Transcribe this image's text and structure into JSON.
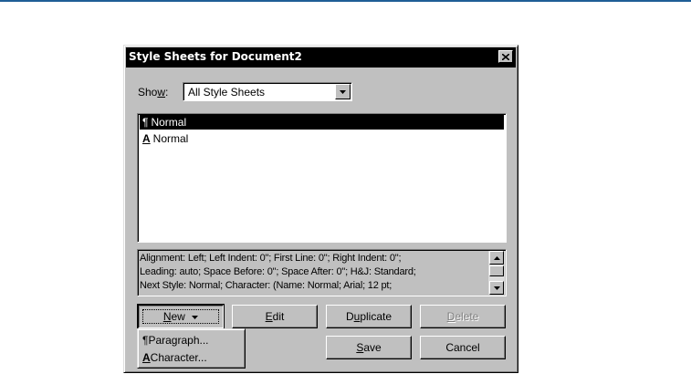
{
  "dialog": {
    "title": "Style Sheets for Document2",
    "close_icon": "close-icon"
  },
  "show": {
    "label": "Show:",
    "label_pre": "Sho",
    "label_accel": "w",
    "label_post": ":",
    "value": "All Style Sheets"
  },
  "styles": [
    {
      "glyph": "¶",
      "name": "Normal",
      "selected": true,
      "icon": "paragraph-icon"
    },
    {
      "glyph": "A",
      "name": "Normal",
      "selected": false,
      "icon": "character-icon"
    }
  ],
  "description": {
    "lines": [
      "Alignment: Left;  Left Indent: 0\";  First Line: 0\";  Right Indent: 0\";",
      "Leading: auto;  Space Before: 0\";  Space After: 0\";  H&J: Standard;",
      " Next Style: Normal;  Character: (Name: Normal;  Arial;  12 pt;"
    ]
  },
  "buttons": {
    "new_accel": "N",
    "new_rest": "ew",
    "edit_accel": "E",
    "edit_rest": "dit",
    "duplicate_pre": "D",
    "duplicate_accel": "u",
    "duplicate_post": "plicate",
    "delete_accel": "D",
    "delete_rest": "elete",
    "save_accel": "S",
    "save_rest": "ave",
    "cancel": "Cancel"
  },
  "new_menu": {
    "paragraph_glyph": "¶",
    "paragraph": "Paragraph...",
    "character_glyph": "A",
    "character": "Character..."
  },
  "colors": {
    "dialog_face": "#c0c0c0",
    "titlebar": "#000000",
    "selection": "#000000",
    "top_rule": "#1f5e96"
  }
}
